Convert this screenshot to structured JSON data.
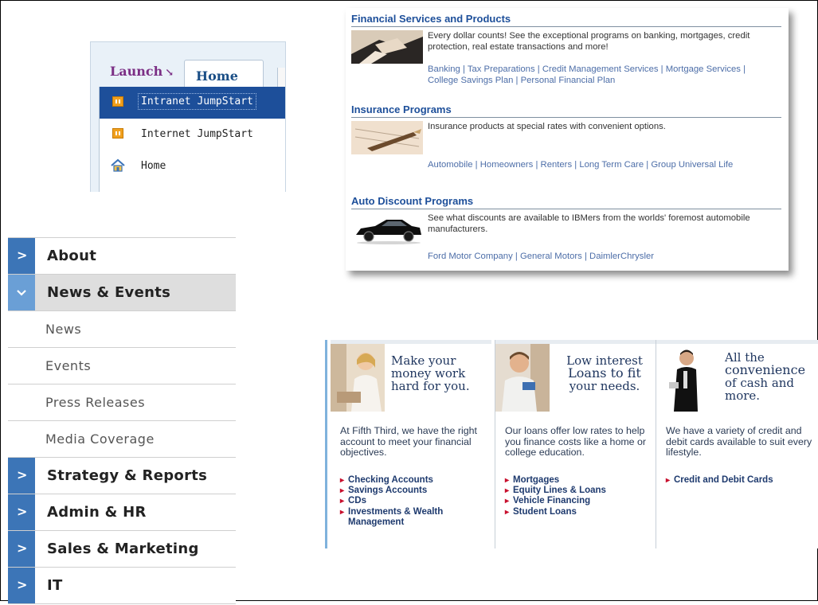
{
  "launch_panel": {
    "launch_tab": "Launch",
    "home_tab": "Home",
    "items": [
      {
        "label": "Intranet JumpStart",
        "icon": "jumpstart-icon",
        "active": true
      },
      {
        "label": "Internet JumpStart",
        "icon": "jumpstart-icon",
        "active": false
      },
      {
        "label": "Home",
        "icon": "house-icon",
        "active": false
      }
    ]
  },
  "accordion_nav": {
    "items": [
      {
        "label": "About",
        "state": "collapsed"
      },
      {
        "label": "News & Events",
        "state": "expanded"
      },
      {
        "label": "News",
        "state": "subitem"
      },
      {
        "label": "Events",
        "state": "subitem"
      },
      {
        "label": "Press Releases",
        "state": "subitem"
      },
      {
        "label": "Media Coverage",
        "state": "subitem"
      },
      {
        "label": "Strategy & Reports",
        "state": "collapsed"
      },
      {
        "label": "Admin & HR",
        "state": "collapsed"
      },
      {
        "label": "Sales & Marketing",
        "state": "collapsed"
      },
      {
        "label": "IT",
        "state": "collapsed"
      }
    ],
    "accent_color": "#3c75b7"
  },
  "financial_panel": {
    "sections": [
      {
        "title": "Financial Services and Products",
        "description": "Every dollar counts! See the exceptional programs on banking, mortgages, credit protection, real estate transactions and more!",
        "links": [
          "Banking",
          "Tax Preparations",
          "Credit Management Services",
          "Mortgage Services",
          "College Savings Plan",
          "Personal Financial Plan"
        ]
      },
      {
        "title": "Insurance Programs",
        "description": "Insurance products at special rates with convenient options.",
        "links": [
          "Automobile",
          "Homeowners",
          "Renters",
          "Long Term Care",
          "Group Universal Life"
        ]
      },
      {
        "title": "Auto Discount Programs",
        "description": "See what discounts are available to IBMers from the worlds' foremost automobile manufacturers.",
        "links": [
          "Ford Motor Company",
          "General Motors",
          "DaimlerChrysler"
        ]
      }
    ],
    "title_color": "#1d4f9a",
    "link_color": "#4d6ea8"
  },
  "fifth_third_banner": {
    "columns": [
      {
        "headline": [
          "Make your",
          "money work",
          "hard for you."
        ],
        "body": "At Fifth Third, we have the right account to meet your financial objectives.",
        "links": [
          "Checking Accounts",
          "Savings Accounts",
          "CDs",
          "Investments & Wealth Management"
        ]
      },
      {
        "headline": [
          "Low interest",
          "Loans to fit",
          "your needs."
        ],
        "body": "Our loans offer low rates to help you finance costs like a home or college education.",
        "links": [
          "Mortgages",
          "Equity Lines & Loans",
          "Vehicle Financing",
          "Student Loans"
        ]
      },
      {
        "headline": [
          "All the",
          "convenience",
          "of cash and",
          "more."
        ],
        "body": "We have a variety of credit and debit cards available to suit every lifestyle.",
        "links": [
          "Credit and Debit Cards"
        ]
      }
    ],
    "bullet_color": "#c8102e"
  }
}
